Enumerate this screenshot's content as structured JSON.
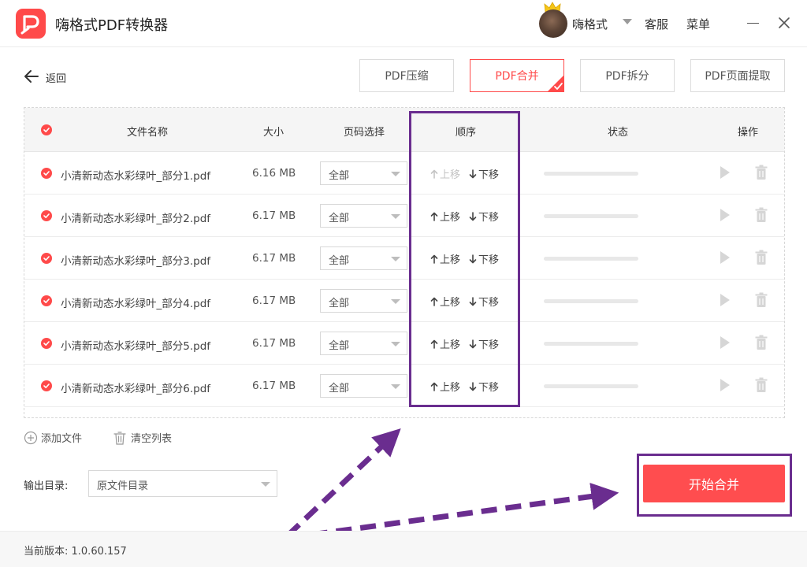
{
  "app": {
    "title": "嗨格式PDF转换器",
    "logo_icon": "pdf-logo-icon",
    "user": {
      "name": "嗨格式",
      "avatar_icon": "user-avatar"
    },
    "links": {
      "support": "客服",
      "menu": "菜单"
    },
    "window_controls": {
      "minimize_icon": "minimize-icon",
      "close_icon": "close-icon"
    }
  },
  "nav": {
    "back_label": "返回",
    "tabs": [
      {
        "label": "PDF压缩",
        "active": false
      },
      {
        "label": "PDF合并",
        "active": true
      },
      {
        "label": "PDF拆分",
        "active": false
      },
      {
        "label": "PDF页面提取",
        "active": false
      }
    ]
  },
  "table": {
    "headers": {
      "name": "文件名称",
      "size": "大小",
      "pages": "页码选择",
      "order": "顺序",
      "status": "状态",
      "actions": "操作"
    },
    "move_up": "上移",
    "move_down": "下移",
    "rows": [
      {
        "name": "小清新动态水彩绿叶_部分1.pdf",
        "size": "6.16 MB",
        "pages": "全部",
        "progress": 0
      },
      {
        "name": "小清新动态水彩绿叶_部分2.pdf",
        "size": "6.17 MB",
        "pages": "全部",
        "progress": 0
      },
      {
        "name": "小清新动态水彩绿叶_部分3.pdf",
        "size": "6.17 MB",
        "pages": "全部",
        "progress": 0
      },
      {
        "name": "小清新动态水彩绿叶_部分4.pdf",
        "size": "6.17 MB",
        "pages": "全部",
        "progress": 0
      },
      {
        "name": "小清新动态水彩绿叶_部分5.pdf",
        "size": "6.17 MB",
        "pages": "全部",
        "progress": 0
      },
      {
        "name": "小清新动态水彩绿叶_部分6.pdf",
        "size": "6.17 MB",
        "pages": "全部",
        "progress": 0
      }
    ]
  },
  "actions": {
    "add_file": "添加文件",
    "clear_list": "清空列表"
  },
  "output": {
    "label": "输出目录:",
    "value": "原文件目录"
  },
  "start_button": "开始合并",
  "footer": {
    "version": "当前版本: 1.0.60.157"
  },
  "colors": {
    "accent": "#ff4a4a",
    "highlight": "#6a2d8f"
  }
}
